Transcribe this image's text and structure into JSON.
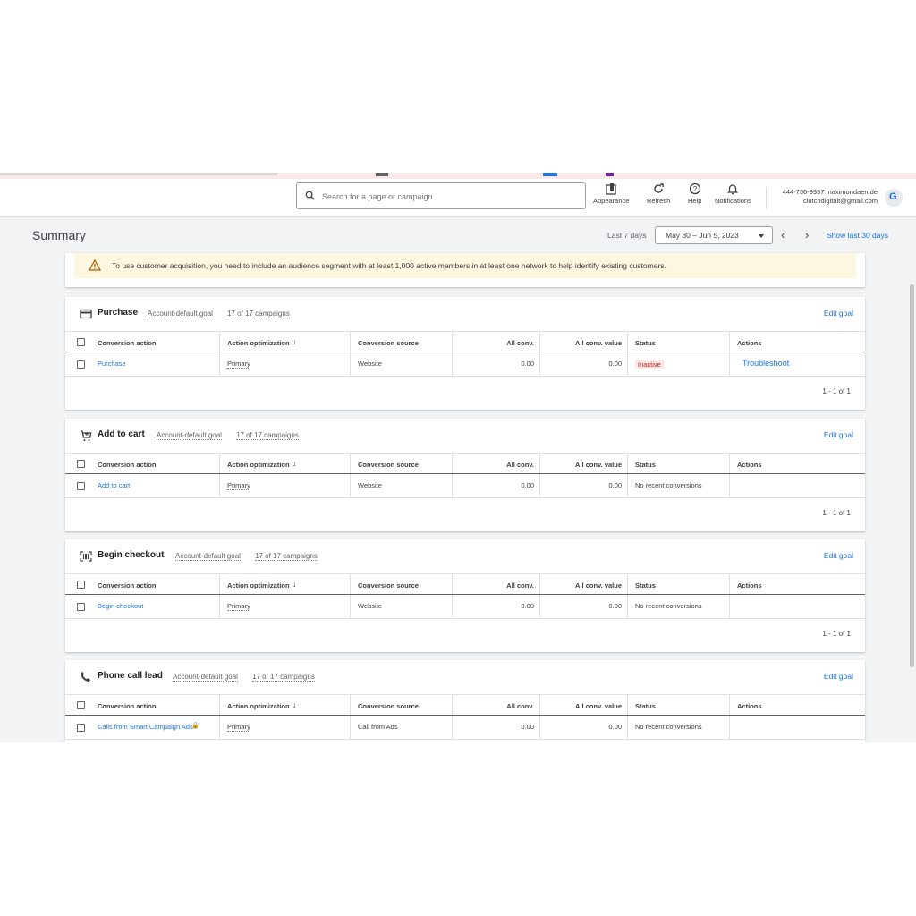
{
  "topbar": {
    "search_placeholder": "Search for a page or campaign",
    "tools": [
      {
        "label": "Appearance",
        "icon": "appearance-icon"
      },
      {
        "label": "Refresh",
        "icon": "refresh-icon"
      },
      {
        "label": "Help",
        "icon": "help-icon"
      },
      {
        "label": "Notifications",
        "icon": "bell-icon"
      }
    ],
    "account_line1": "444-736-9937 maximondaen.de",
    "account_line2": "clutchdigitalt@gmail.com"
  },
  "header": {
    "title": "Summary",
    "range_label": "Last 7 days",
    "date_range": "May 30 – Jun 5, 2023",
    "show_last": "Show last 30 days"
  },
  "warning": {
    "text": "To use customer acquisition, you need to include an audience segment with at least 1,000 active members in at least one network to help identify existing customers."
  },
  "columns": {
    "conversion_action": "Conversion action",
    "action_optimization": "Action optimization",
    "conversion_source": "Conversion source",
    "all_conv": "All conv.",
    "all_conv_value": "All conv. value",
    "status": "Status",
    "actions": "Actions"
  },
  "goals": [
    {
      "title": "Purchase",
      "goal_type": "Account-default goal",
      "campaigns": "17 of 17 campaigns",
      "edit": "Edit goal",
      "icon": "credit-card-icon",
      "row": {
        "action": "Purchase",
        "optimization": "Primary",
        "source": "Website",
        "all_conv": "0.00",
        "all_conv_value": "0.00",
        "status": "Inactive",
        "actions": "Troubleshoot"
      },
      "pager": "1 - 1 of 1"
    },
    {
      "title": "Add to cart",
      "goal_type": "Account-default goal",
      "campaigns": "17 of 17 campaigns",
      "edit": "Edit goal",
      "icon": "cart-icon",
      "row": {
        "action": "Add to cart",
        "optimization": "Primary",
        "source": "Website",
        "all_conv": "0.00",
        "all_conv_value": "0.00",
        "status": "No recent conversions",
        "actions": ""
      },
      "pager": "1 - 1 of 1"
    },
    {
      "title": "Begin checkout",
      "goal_type": "Account-default goal",
      "campaigns": "17 of 17 campaigns",
      "edit": "Edit goal",
      "icon": "barcode-scan-icon",
      "row": {
        "action": "Begin checkout",
        "optimization": "Primary",
        "source": "Website",
        "all_conv": "0.00",
        "all_conv_value": "0.00",
        "status": "No recent conversions",
        "actions": ""
      },
      "pager": "1 - 1 of 1"
    },
    {
      "title": "Phone call lead",
      "goal_type": "Account-default goal",
      "campaigns": "17 of 17 campaigns",
      "edit": "Edit goal",
      "icon": "phone-icon",
      "row": {
        "action": "Calls from Smart Campaign Ads",
        "optimization": "Primary",
        "source": "Call from Ads",
        "all_conv": "0.00",
        "all_conv_value": "0.00",
        "status": "No recent conversions",
        "actions": ""
      },
      "pager": ""
    }
  ],
  "colors": {
    "accent": "#1a73e8",
    "inactive_bg": "#fce8e6",
    "inactive_text": "#c5221f",
    "warning_bg": "#fef7e0"
  }
}
